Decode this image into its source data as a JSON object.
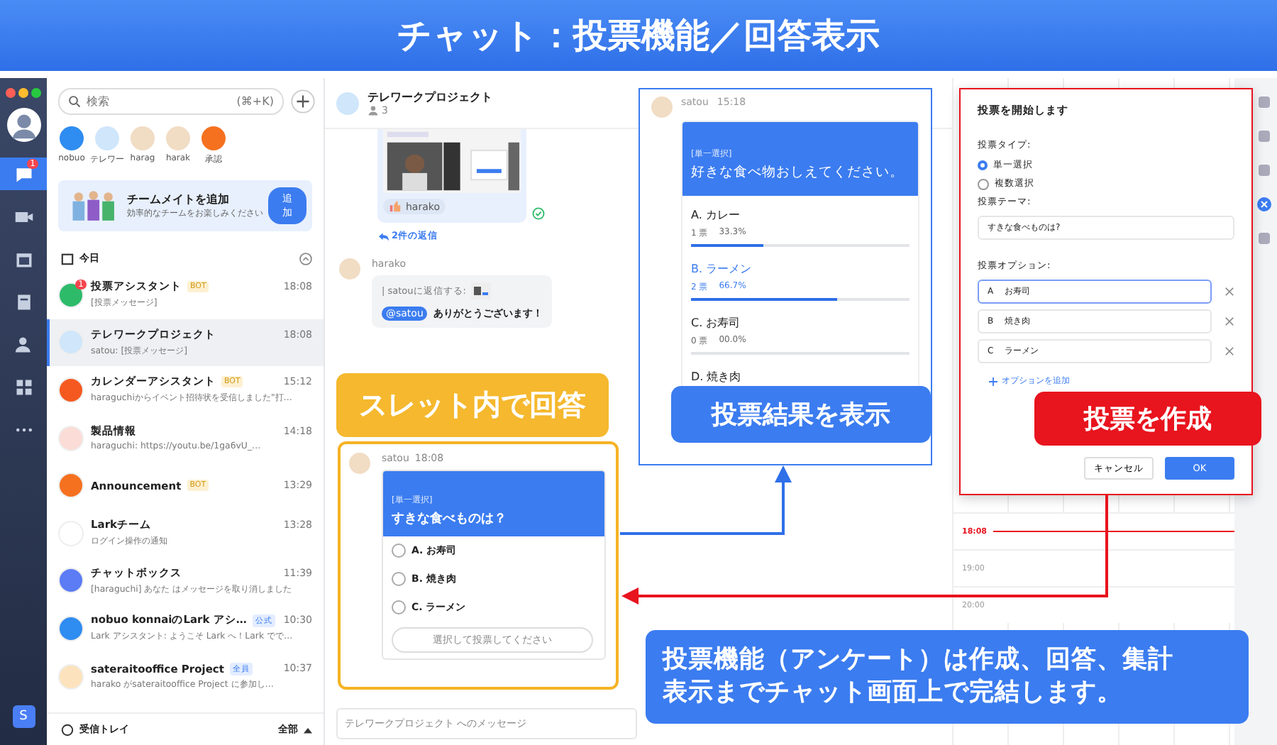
{
  "banner": {
    "title": "チャット：投票機能／回答表示"
  },
  "rail": {
    "items": [
      {
        "kind": "chat",
        "selected": true,
        "badge": "1"
      },
      {
        "kind": "video",
        "selected": false
      },
      {
        "kind": "calendar",
        "selected": false
      },
      {
        "kind": "docs",
        "selected": false
      },
      {
        "kind": "contacts",
        "selected": false
      },
      {
        "kind": "apps",
        "selected": false
      },
      {
        "kind": "more",
        "selected": false
      }
    ],
    "account": "S"
  },
  "chat_list": {
    "search": {
      "placeholder": "検索",
      "shortcut": "(⌘+K)"
    },
    "pinned": [
      {
        "label": "nobuo",
        "color": "#2f8cf0"
      },
      {
        "label": "テレワー",
        "color": "#cfe6fb"
      },
      {
        "label": "harag",
        "color": "#f1dcc4"
      },
      {
        "label": "harak",
        "color": "#f1dcc4"
      },
      {
        "label": "承認",
        "color": "#f5711f"
      }
    ],
    "invite": {
      "title": "チームメイトを追加",
      "subtitle": "効率的なチームをお楽しみください",
      "button": "追加"
    },
    "section": "今日",
    "items": [
      {
        "name": "投票アシスタント",
        "tag": {
          "kind": "bot",
          "text": "BOT"
        },
        "time": "18:08",
        "preview": "[投票メッセージ]",
        "badge": "1",
        "color": "#2dbb6a",
        "selected": false
      },
      {
        "name": "テレワークプロジェクト",
        "time": "18:08",
        "preview": "satou: [投票メッセージ]",
        "color": "#cfe6fb",
        "selected": true
      },
      {
        "name": "カレンダーアシスタント",
        "tag": {
          "kind": "bot",
          "text": "BOT"
        },
        "time": "15:12",
        "preview": "haraguchiからイベント招待状を受信しました\"打…",
        "color": "#f5591f",
        "selected": false
      },
      {
        "name": "製品情報",
        "time": "14:18",
        "preview": "haraguchi: https://youtu.be/1ga6vU_…",
        "color": "#fcdcd6",
        "selected": false
      },
      {
        "name": "Announcement",
        "tag": {
          "kind": "bot",
          "text": "BOT"
        },
        "time": "13:29",
        "color": "#f5711f",
        "selected": false
      },
      {
        "name": "Larkチーム",
        "time": "13:28",
        "preview": "ログイン操作の通知",
        "color": "#ffffff",
        "selected": false
      },
      {
        "name": "チャットボックス",
        "time": "11:39",
        "preview": "[haraguchi] あなた はメッセージを取り消しました",
        "color": "#5b7cf5",
        "selected": false
      },
      {
        "name": "nobuo konnaiのLark アシ…",
        "tag": {
          "kind": "official",
          "text": "公式"
        },
        "time": "10:30",
        "preview": "Lark アシスタント: ようこそ Lark へ！Lark でで…",
        "color": "#2f8cf0",
        "selected": false
      },
      {
        "name": "sateraitooffice Project",
        "tag": {
          "kind": "all",
          "text": "全員"
        },
        "time": "10:37",
        "preview": "harako がsateraitooffice Project に参加し…",
        "color": "#fde3bd",
        "selected": false
      }
    ],
    "footer": {
      "label": "受信トレイ",
      "filter": "全部"
    }
  },
  "chat": {
    "title": "テレワークプロジェクト",
    "members": "3",
    "shared_post": {
      "kind": "picture",
      "reaction": "harako"
    },
    "replies_link": "2件の返信",
    "reply": {
      "sender": "harako",
      "quote": "| satouに返信する:",
      "mention": "@satou",
      "text": "ありがとうございます！"
    },
    "vote": {
      "sender": "satou",
      "time": "18:08",
      "type": "[単一選択]",
      "question": "すきな食べものは？",
      "options": [
        "A. お寿司",
        "B. 焼き肉",
        "C. ラーメン"
      ],
      "button": "選択して投票してください"
    },
    "composer": {
      "placeholder": "テレワークプロジェクト へのメッセージ"
    }
  },
  "results": {
    "sender": "satou",
    "time": "15:18",
    "type": "[単一選択]",
    "question": "好きな食べ物おしえてください。",
    "options": [
      {
        "label": "A. カレー",
        "votes": "1 票",
        "percent": "33.3%",
        "level": 0.333,
        "selected": false
      },
      {
        "label": "B. ラーメン",
        "votes": "2 票",
        "percent": "66.7%",
        "level": 0.667,
        "selected": true
      },
      {
        "label": "C. お寿司",
        "votes": "0 票",
        "percent": "00.0%",
        "level": 0,
        "selected": false
      },
      {
        "label": "D. 焼き肉",
        "selected": false
      }
    ]
  },
  "dialog": {
    "title": "投票を開始します",
    "type_label": "投票タイプ:",
    "types": [
      {
        "label": "単一選択",
        "selected": true
      },
      {
        "label": "複数選択",
        "selected": false
      }
    ],
    "theme_label": "投票テーマ:",
    "theme": "すきな食べものは?",
    "options_label": "投票オプション:",
    "options": [
      {
        "letter": "A",
        "value": "お寿司",
        "focused": true
      },
      {
        "letter": "B",
        "value": "焼き肉",
        "focused": false
      },
      {
        "letter": "C",
        "value": "ラーメン",
        "focused": false
      }
    ],
    "add_option": "オプションを追加",
    "cancel": "キャンセル",
    "ok": "OK"
  },
  "calendar": {
    "times": [
      {
        "label": "18:08",
        "now": true
      },
      {
        "label": "19:00",
        "now": false
      },
      {
        "label": "20:00",
        "now": false
      }
    ]
  },
  "callouts": [
    {
      "kind": "orange",
      "text": "スレット内で回答"
    },
    {
      "kind": "blue",
      "text": "投票結果を表示"
    },
    {
      "kind": "red",
      "text": "投票を作成"
    },
    {
      "kind": "note",
      "lines": [
        "投票機能（アンケート）は作成、回答、集計",
        "表示までチャット画面上で完結します。"
      ]
    }
  ]
}
